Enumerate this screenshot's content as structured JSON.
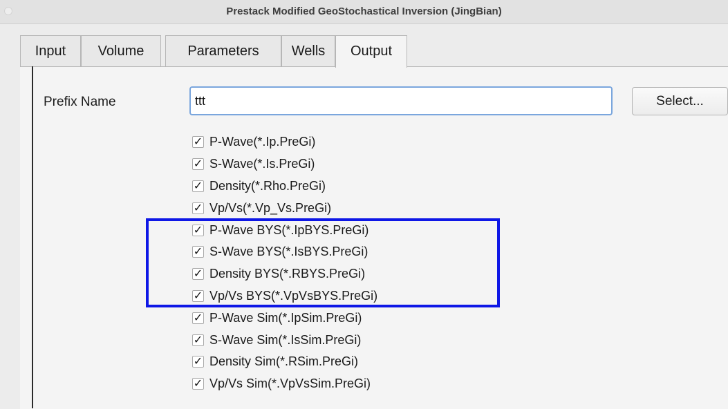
{
  "window": {
    "title": "Prestack Modified GeoStochastical Inversion (JingBian)"
  },
  "tabs": [
    {
      "label": "Input"
    },
    {
      "label": "Volume"
    },
    {
      "label": "Parameters"
    },
    {
      "label": "Wells"
    },
    {
      "label": "Output",
      "active": true
    }
  ],
  "output": {
    "prefix_label": "Prefix Name",
    "prefix_value": "ttt",
    "select_label": "Select...",
    "check_mark": "✓",
    "options": [
      {
        "label": "P-Wave(*.Ip.PreGi)",
        "checked": true
      },
      {
        "label": "S-Wave(*.Is.PreGi)",
        "checked": true
      },
      {
        "label": "Density(*.Rho.PreGi)",
        "checked": true
      },
      {
        "label": "Vp/Vs(*.Vp_Vs.PreGi)",
        "checked": true
      },
      {
        "label": "P-Wave BYS(*.IpBYS.PreGi)",
        "checked": true
      },
      {
        "label": "S-Wave BYS(*.IsBYS.PreGi)",
        "checked": true
      },
      {
        "label": "Density BYS(*.RBYS.PreGi)",
        "checked": true
      },
      {
        "label": "Vp/Vs BYS(*.VpVsBYS.PreGi)",
        "checked": true
      },
      {
        "label": "P-Wave Sim(*.IpSim.PreGi)",
        "checked": true
      },
      {
        "label": "S-Wave Sim(*.IsSim.PreGi)",
        "checked": true
      },
      {
        "label": "Density Sim(*.RSim.PreGi)",
        "checked": true
      },
      {
        "label": "Vp/Vs Sim(*.VpVsSim.PreGi)",
        "checked": true
      }
    ]
  },
  "colors": {
    "highlight": "#0e17e6",
    "focus_ring": "#7aa6dd"
  }
}
